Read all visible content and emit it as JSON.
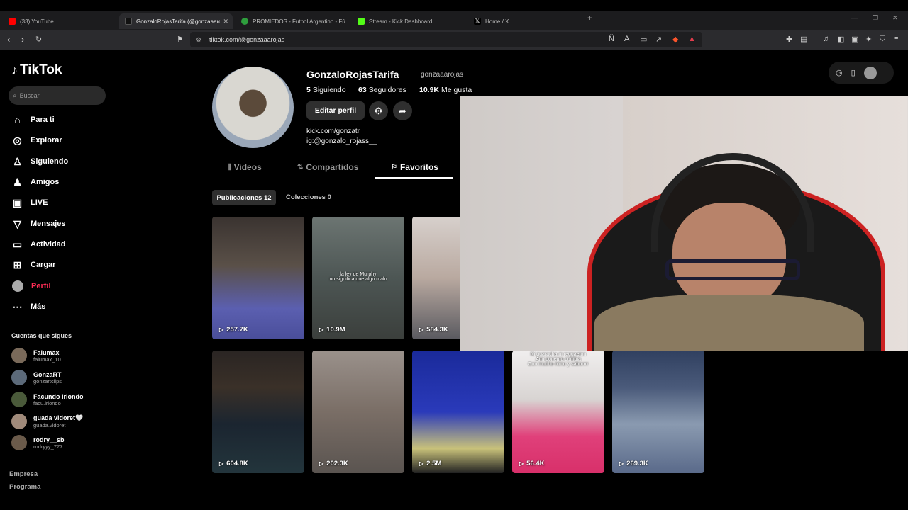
{
  "browser": {
    "tabs": [
      {
        "label": "(33) YouTube",
        "color": "#ff0000"
      },
      {
        "label": "GonzaloRojasTarifa (@gonzaaarojas",
        "color": "#111111"
      },
      {
        "label": "PROMIEDOS - Futbol Argentino - Fú",
        "color": "#2e9e3d"
      },
      {
        "label": "Stream - Kick Dashboard",
        "color": "#53fc18"
      },
      {
        "label": "Home / X",
        "color": "#000000"
      }
    ],
    "new_tab": "+",
    "url": "tiktok.com/@gonzaaarojas"
  },
  "sidebar": {
    "logo": "TikTok",
    "search_placeholder": "Buscar",
    "nav": [
      {
        "label": "Para ti",
        "icon": "home-icon",
        "glyph": "⌂"
      },
      {
        "label": "Explorar",
        "icon": "compass-icon",
        "glyph": "◎"
      },
      {
        "label": "Siguiendo",
        "icon": "following-icon",
        "glyph": "♙"
      },
      {
        "label": "Amigos",
        "icon": "friends-icon",
        "glyph": "♟"
      },
      {
        "label": "LIVE",
        "icon": "live-icon",
        "glyph": "▣"
      },
      {
        "label": "Mensajes",
        "icon": "messages-icon",
        "glyph": "▽"
      },
      {
        "label": "Actividad",
        "icon": "activity-icon",
        "glyph": "▭"
      },
      {
        "label": "Cargar",
        "icon": "upload-icon",
        "glyph": "⊞"
      },
      {
        "label": "Perfil",
        "icon": "profile-avatar",
        "glyph": ""
      },
      {
        "label": "Más",
        "icon": "more-icon",
        "glyph": "⋯"
      }
    ],
    "following_title": "Cuentas que sigues",
    "following": [
      {
        "name": "Falumax",
        "handle": "falumax_10"
      },
      {
        "name": "GonzaRT",
        "handle": "gonzartclips"
      },
      {
        "name": "Facundo Iriondo",
        "handle": "facu.iriondo"
      },
      {
        "name": "guada vidoret🤍",
        "handle": "guada.vidoret"
      },
      {
        "name": "rodry__sb",
        "handle": "rodryyy_777"
      }
    ],
    "footer": [
      "Empresa",
      "Programa"
    ]
  },
  "profile": {
    "name": "GonzaloRojasTarifa",
    "handle": "gonzaaarojas",
    "stats": [
      {
        "value": "5",
        "label": "Siguiendo"
      },
      {
        "value": "63",
        "label": "Seguidores"
      },
      {
        "value": "10.9K",
        "label": "Me gusta"
      }
    ],
    "edit_button": "Editar perfil",
    "bio_line1": "kick.com/gonzatr",
    "bio_line2": "ig:@gonzalo_rojass__",
    "tabs": [
      "Videos",
      "Compartidos",
      "Favoritos"
    ],
    "sub_tabs": [
      "Publicaciones 12",
      "Colecciones 0"
    ]
  },
  "videos": [
    {
      "views": "257.7K",
      "caption": ""
    },
    {
      "views": "10.9M",
      "caption": "la ley de Murphy\nno significa que algo malo"
    },
    {
      "views": "584.3K",
      "caption": ""
    },
    {
      "views": "604.8K",
      "caption": ""
    },
    {
      "views": "202.3K",
      "caption": ""
    },
    {
      "views": "2.5M",
      "caption": ""
    },
    {
      "views": "56.4K",
      "caption": "Ni guaracha ni reggaeton\nAmi ponemo cumbia\nCon mucho ritmo y saborrrr"
    },
    {
      "views": "269.3K",
      "caption": ""
    }
  ]
}
